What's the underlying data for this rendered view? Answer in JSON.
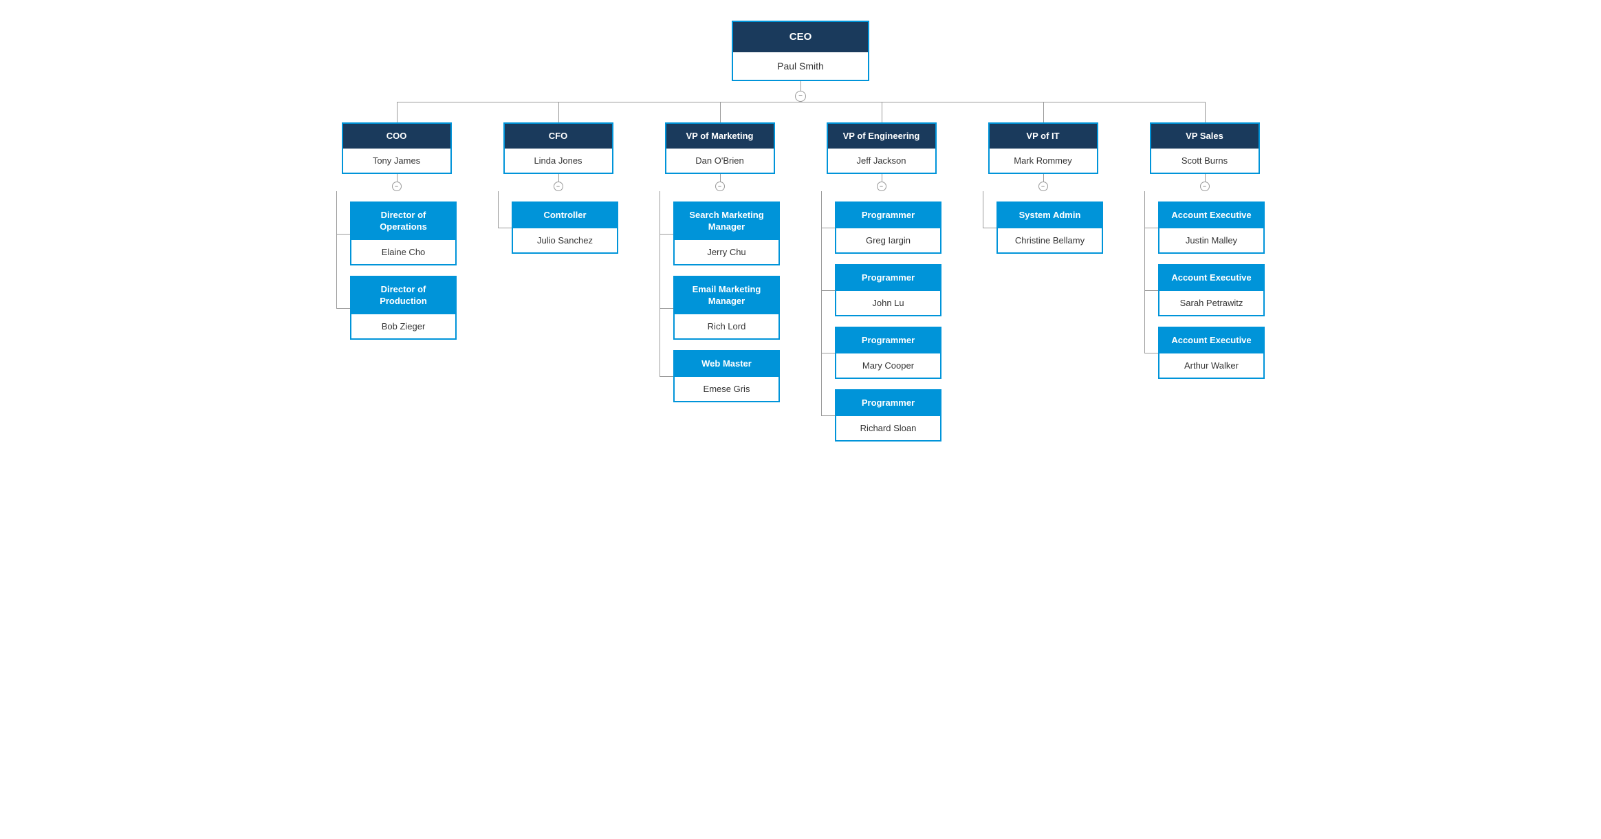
{
  "ceo": {
    "title": "CEO",
    "name": "Paul Smith"
  },
  "l2": [
    {
      "id": "coo",
      "title": "COO",
      "name": "Tony James",
      "children": [
        {
          "title": "Director of\nOperations",
          "name": "Elaine Cho"
        },
        {
          "title": "Director of\nProduction",
          "name": "Bob Zieger"
        }
      ]
    },
    {
      "id": "cfo",
      "title": "CFO",
      "name": "Linda Jones",
      "children": [
        {
          "title": "Controller",
          "name": "Julio Sanchez"
        }
      ]
    },
    {
      "id": "vp-marketing",
      "title": "VP of Marketing",
      "name": "Dan O'Brien",
      "children": [
        {
          "title": "Search Marketing\nManager",
          "name": "Jerry Chu"
        },
        {
          "title": "Email Marketing\nManager",
          "name": "Rich Lord"
        },
        {
          "title": "Web Master",
          "name": "Emese Gris"
        }
      ]
    },
    {
      "id": "vp-engineering",
      "title": "VP of Engineering",
      "name": "Jeff Jackson",
      "children": [
        {
          "title": "Programmer",
          "name": "Greg Iargin"
        },
        {
          "title": "Programmer",
          "name": "John Lu"
        },
        {
          "title": "Programmer",
          "name": "Mary Cooper"
        },
        {
          "title": "Programmer",
          "name": "Richard Sloan"
        }
      ]
    },
    {
      "id": "vp-it",
      "title": "VP of IT",
      "name": "Mark Rommey",
      "children": [
        {
          "title": "System Admin",
          "name": "Christine Bellamy"
        }
      ]
    },
    {
      "id": "vp-sales",
      "title": "VP Sales",
      "name": "Scott Burns",
      "children": [
        {
          "title": "Account Executive",
          "name": "Justin Malley"
        },
        {
          "title": "Account Executive",
          "name": "Sarah Petrawitz"
        },
        {
          "title": "Account Executive",
          "name": "Arthur Walker"
        }
      ]
    }
  ],
  "icons": {
    "collapse": "−"
  }
}
